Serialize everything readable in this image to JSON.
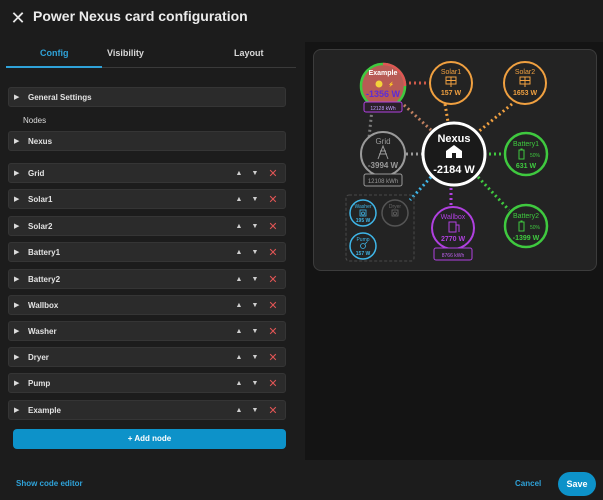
{
  "dialog": {
    "title": "Power Nexus card configuration"
  },
  "tabs": [
    "Config",
    "Visibility",
    "Layout"
  ],
  "editor": {
    "general_settings": "General Settings",
    "nodes_heading": "Nodes",
    "nexus": "Nexus",
    "nodes": [
      "Grid",
      "Solar1",
      "Solar2",
      "Battery1",
      "Battery2",
      "Wallbox",
      "Washer",
      "Dryer",
      "Pump",
      "Example"
    ],
    "up_arrow": "▲",
    "down_arrow": "▼",
    "delete_glyph": "✕",
    "add_node": "+ Add node"
  },
  "footer": {
    "show_code": "Show code editor",
    "cancel": "Cancel",
    "save": "Save"
  },
  "preview": {
    "nexus": {
      "label": "Nexus",
      "value": "-2184 W"
    },
    "example": {
      "label": "Example",
      "value": "-1356 W",
      "sub": "12128 kWh"
    },
    "solar1": {
      "label": "Solar1",
      "value": "157 W"
    },
    "solar2": {
      "label": "Solar2",
      "value": "1653 W"
    },
    "grid": {
      "label": "Grid",
      "value": "-3994 W",
      "sub": "12108 kWh"
    },
    "battery1": {
      "label": "Battery1",
      "value": "631 W",
      "soc": "50%"
    },
    "battery2": {
      "label": "Battery2",
      "value": "-1399 W",
      "soc": "50%"
    },
    "wallbox": {
      "label": "Wallbox",
      "value": "2770 W",
      "sub": "8766 kWh"
    },
    "washer": {
      "label": "Washer",
      "value": "195 W"
    },
    "dryer": {
      "label": "Dryer"
    },
    "pump": {
      "label": "Pump",
      "value": "157 W"
    }
  },
  "colors": {
    "accent": "#0d92c9",
    "solar": "#f0a040",
    "battery": "#3fc93f",
    "wallbox": "#b040e0",
    "washer": "#3fb6e8",
    "grid": "#9a9a9a",
    "delete": "#e05555"
  },
  "icons": {
    "close": "close-icon",
    "expand": "chevron-right-icon",
    "solar": "solar-panel-icon",
    "grid": "transmission-tower-icon",
    "battery": "battery-charging-icon",
    "home": "home-icon",
    "wallbox": "ev-charger-icon",
    "washer": "washing-machine-icon",
    "pump": "pump-icon"
  }
}
